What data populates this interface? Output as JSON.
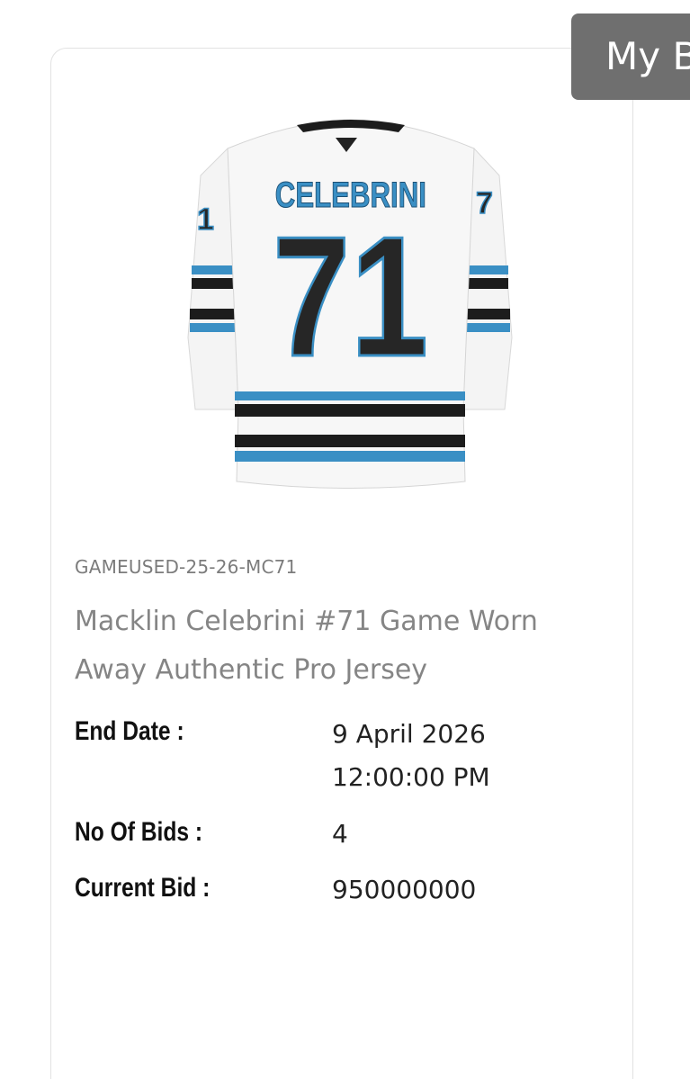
{
  "header": {
    "my_button_label": "My B"
  },
  "jersey_image": {
    "nameplate": "CELEBRINI",
    "number": "71",
    "colors": {
      "body": "#f6f6f6",
      "stripe_teal": "#3a8fc4",
      "stripe_black": "#1c1c1c",
      "number_fill": "#262626"
    }
  },
  "lot": {
    "number": "GAMEUSED-25-26-MC71",
    "title": "Macklin Celebrini #71 Game Worn Away Authentic Pro Jersey"
  },
  "details": {
    "end_date_label": "End Date :",
    "end_date_value_line1": "9 April 2026",
    "end_date_value_line2": "12:00:00 PM",
    "bids_label": "No Of Bids :",
    "bids_value": "4",
    "current_bid_label": "Current Bid :",
    "current_bid_value": "950000000"
  }
}
